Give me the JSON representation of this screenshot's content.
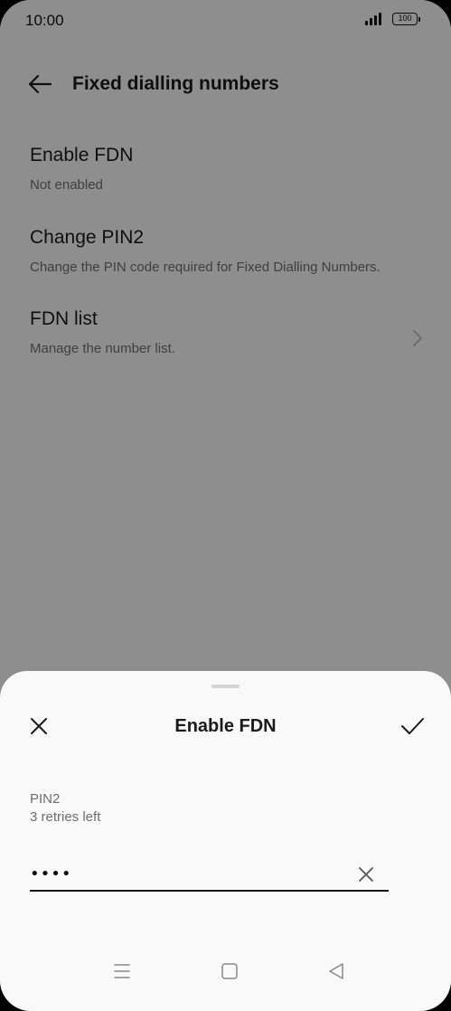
{
  "status_bar": {
    "time": "10:00",
    "battery": "100"
  },
  "header": {
    "title": "Fixed dialling numbers"
  },
  "settings": [
    {
      "title": "Enable FDN",
      "subtitle": "Not enabled"
    },
    {
      "title": "Change PIN2",
      "subtitle": "Change the PIN code required for Fixed Dialling Numbers."
    },
    {
      "title": "FDN list",
      "subtitle": "Manage the number list."
    }
  ],
  "sheet": {
    "title": "Enable FDN",
    "field_label": "PIN2",
    "field_hint": "3 retries left",
    "pin_value": "••••"
  },
  "icons": {
    "back": "back-arrow-icon",
    "chevron": "chevron-right-icon",
    "close": "close-icon",
    "confirm": "check-icon",
    "clear": "clear-icon",
    "nav_menu": "menu-icon",
    "nav_home": "home-icon",
    "nav_back": "triangle-back-icon"
  },
  "colors": {
    "scrim": "#8f8f8f",
    "sheet_bg": "#f9f9f9",
    "text_primary": "#1a1a1a",
    "text_secondary": "#6d6d6d"
  }
}
